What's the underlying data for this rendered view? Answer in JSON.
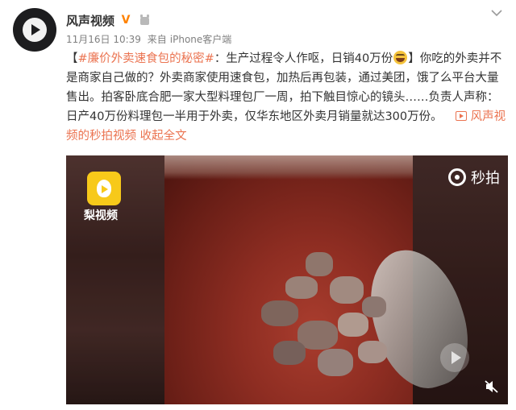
{
  "post": {
    "author": "风声视频",
    "verified_mark": "V",
    "time": "11月16日 10:39",
    "via": "来自",
    "source": "iPhone客户端",
    "text": {
      "open_bracket": "【",
      "hashtag": "#廉价外卖速食包的秘密#",
      "headline": "：生产过程令人作呕，日销40万份",
      "close_bracket": "】",
      "body": "你吃的外卖并不是商家自己做的？外卖商家使用速食包，加热后再包装，通过美团，饿了么平台大量售出。拍客卧底合肥一家大型料理包厂一周，拍下触目惊心的镜头……负责人声称：日产40万份料理包一半用于外卖，仅华东地区外卖月销量就达300万份。"
    },
    "video_link": "风声视频的秒拍视频",
    "expand": "收起全文",
    "video": {
      "watermark_left": "梨视频",
      "watermark_right": "秒拍"
    }
  },
  "colors": {
    "link": "#eb7350",
    "meta": "#808080",
    "verified": "#ff8200",
    "pear_brand": "#f7c91a"
  },
  "icons": [
    "avatar-play-icon",
    "verified-icon",
    "member-icon",
    "chevron-down-icon",
    "emoji-icon",
    "video-link-icon",
    "pear-video-logo-icon",
    "miaopai-logo-icon",
    "play-icon",
    "mute-icon"
  ]
}
